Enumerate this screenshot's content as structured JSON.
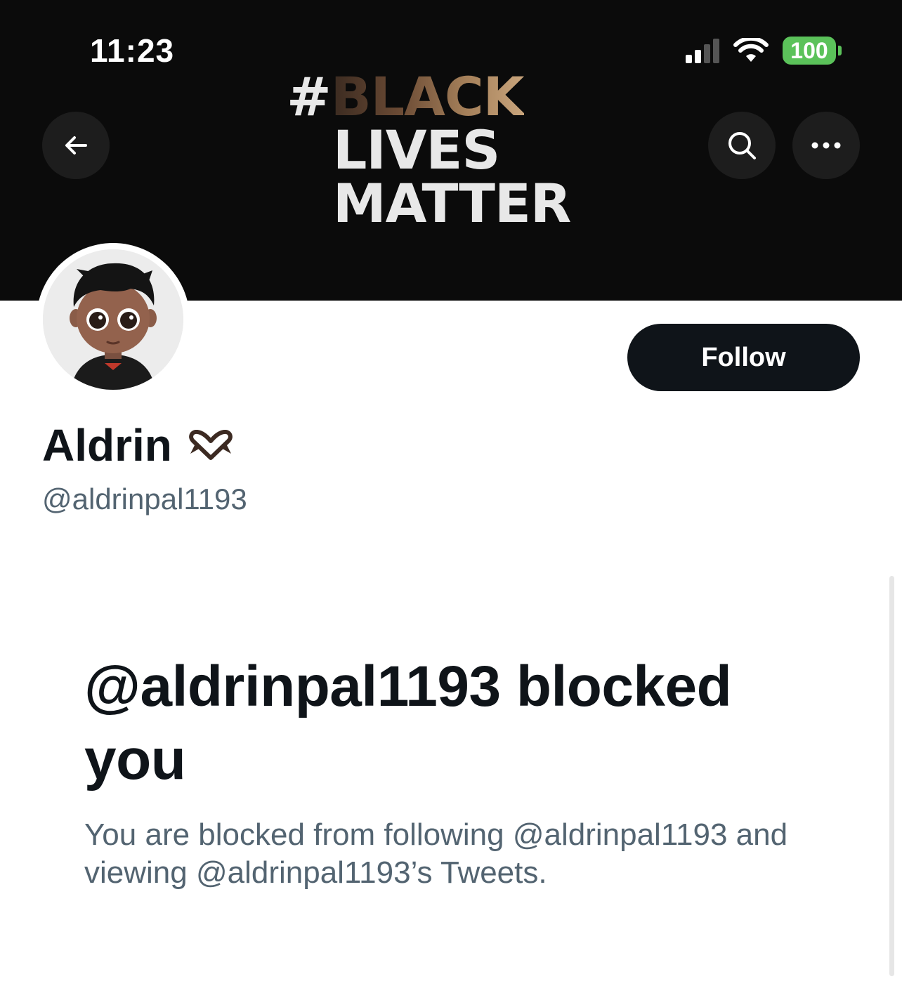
{
  "status_bar": {
    "time": "11:23",
    "battery": "100",
    "signal_icon": "cellular-signal-icon",
    "wifi_icon": "wifi-icon"
  },
  "banner": {
    "line1_hash": "#",
    "line1_word": "BLACK",
    "line2": "LIVES",
    "line3": "MATTER"
  },
  "header": {
    "back_icon": "arrow-left-icon",
    "search_icon": "search-icon",
    "more_icon": "more-horizontal-icon"
  },
  "profile": {
    "display_name": "Aldrin",
    "name_emoji": "heart-hands-emoji",
    "handle": "@aldrinpal1193",
    "follow_label": "Follow"
  },
  "blocked": {
    "title": "@aldrinpal1193 blocked you",
    "description": "You are blocked from following @aldrinpal1193 and viewing @aldrinpal1193’s Tweets."
  },
  "colors": {
    "banner_bg": "#0b0b0b",
    "primary_text": "#0f1419",
    "secondary_text": "#536471",
    "follow_bg": "#0f1419",
    "battery_green": "#5bc25a"
  }
}
